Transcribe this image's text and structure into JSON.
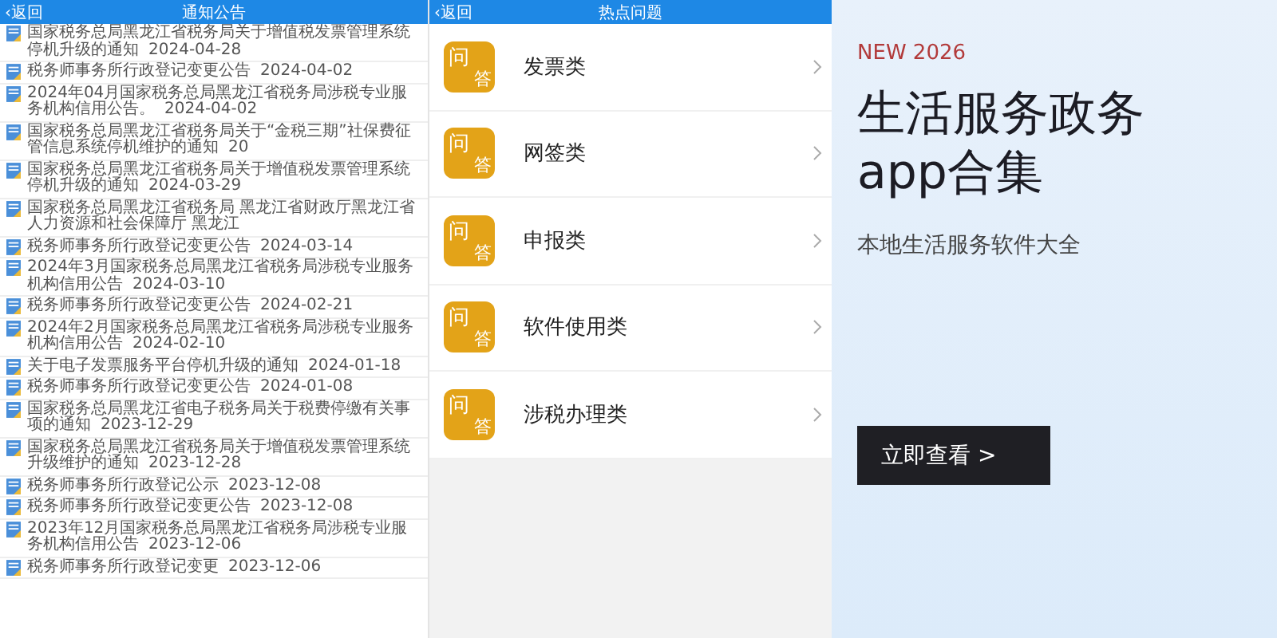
{
  "notice_panel": {
    "back": "‹返回",
    "title": "通知公告",
    "items": [
      {
        "title": "国家税务总局黑龙江省税务局关于增值税发票管理系统停机升级的通知",
        "date": "2024-04-28"
      },
      {
        "title": "税务师事务所行政登记变更公告",
        "date": "2024-04-02"
      },
      {
        "title": "2024年04月国家税务总局黑龙江省税务局涉税专业服务机构信用公告。",
        "date": "2024-04-02"
      },
      {
        "title": "国家税务总局黑龙江省税务局关于“金税三期”社保费征管信息系统停机维护的通知",
        "date": "20"
      },
      {
        "title": "国家税务总局黑龙江省税务局关于增值税发票管理系统停机升级的通知",
        "date": "2024-03-29"
      },
      {
        "title": "国家税务总局黑龙江省税务局 黑龙江省财政厅黑龙江省人力资源和社会保障厅 黑龙江"
      },
      {
        "title": "税务师事务所行政登记变更公告",
        "date": "2024-03-14"
      },
      {
        "title": "2024年3月国家税务总局黑龙江省税务局涉税专业服务机构信用公告",
        "date": "2024-03-10"
      },
      {
        "title": "税务师事务所行政登记变更公告",
        "date": "2024-02-21"
      },
      {
        "title": "2024年2月国家税务总局黑龙江省税务局涉税专业服务机构信用公告",
        "date": "2024-02-10"
      },
      {
        "title": "关于电子发票服务平台停机升级的通知",
        "date": "2024-01-18"
      },
      {
        "title": "税务师事务所行政登记变更公告",
        "date": "2024-01-08"
      },
      {
        "title": "国家税务总局黑龙江省电子税务局关于税费停缴有关事项的通知",
        "date": "2023-12-29"
      },
      {
        "title": "国家税务总局黑龙江省税务局关于增值税发票管理系统升级维护的通知",
        "date": "2023-12-28"
      },
      {
        "title": "税务师事务所行政登记公示",
        "date": "2023-12-08"
      },
      {
        "title": "税务师事务所行政登记变更公告",
        "date": "2023-12-08"
      },
      {
        "title": "2023年12月国家税务总局黑龙江省税务局涉税专业服务机构信用公告",
        "date": "2023-12-06"
      },
      {
        "title": "税务师事务所行政登记变更",
        "date": "2023-12-06"
      }
    ]
  },
  "faq_panel": {
    "back": "‹返回",
    "title": "热点问题",
    "items": [
      {
        "badge_top": "问",
        "badge_bottom": "答",
        "label": "发票类"
      },
      {
        "badge_top": "问",
        "badge_bottom": "答",
        "label": "网签类"
      },
      {
        "badge_top": "问",
        "badge_bottom": "答",
        "label": "申报类"
      },
      {
        "badge_top": "问",
        "badge_bottom": "答",
        "label": "软件使用类"
      },
      {
        "badge_top": "问",
        "badge_bottom": "答",
        "label": "涉税办理类"
      }
    ]
  },
  "promo": {
    "tag": "NEW 2026",
    "headline": "生活服务政务app合集",
    "subtitle": "本地生活服务软件大全",
    "button": "立即查看 >"
  }
}
